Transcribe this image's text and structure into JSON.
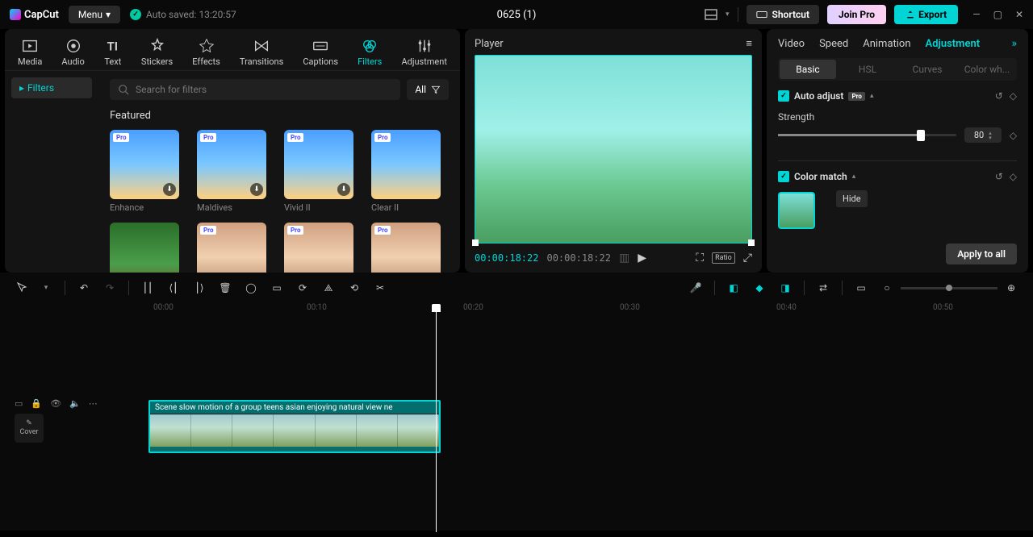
{
  "titlebar": {
    "logo": "CapCut",
    "menu": "Menu",
    "autosave": "Auto saved: 13:20:57",
    "project_title": "0625 (1)",
    "shortcut": "Shortcut",
    "join_pro": "Join Pro",
    "export": "Export"
  },
  "media_tabs": {
    "media": "Media",
    "audio": "Audio",
    "text": "Text",
    "stickers": "Stickers",
    "effects": "Effects",
    "transitions": "Transitions",
    "captions": "Captions",
    "filters": "Filters",
    "adjustment": "Adjustment"
  },
  "filters_panel": {
    "sidebar_label": "Filters",
    "search_placeholder": "Search for filters",
    "all": "All",
    "section": "Featured",
    "items": {
      "0": {
        "label": "Enhance",
        "pro": "Pro"
      },
      "1": {
        "label": "Maldives",
        "pro": "Pro"
      },
      "2": {
        "label": "Vivid II",
        "pro": "Pro"
      },
      "3": {
        "label": "Clear II",
        "pro": "Pro"
      },
      "4": {
        "label": "",
        "pro": ""
      },
      "5": {
        "label": "",
        "pro": "Pro"
      },
      "6": {
        "label": "",
        "pro": "Pro"
      },
      "7": {
        "label": "",
        "pro": "Pro"
      }
    }
  },
  "player": {
    "title": "Player",
    "current": "00:00:18:22",
    "total": "00:00:18:22",
    "ratio": "Ratio"
  },
  "right": {
    "tabs": {
      "video": "Video",
      "speed": "Speed",
      "animation": "Animation",
      "adjustment": "Adjustment"
    },
    "subtabs": {
      "basic": "Basic",
      "hsl": "HSL",
      "curves": "Curves",
      "colorwheel": "Color wh..."
    },
    "auto_adjust": "Auto adjust",
    "pro": "Pro",
    "strength": "Strength",
    "strength_value": "80",
    "color_match": "Color match",
    "hide": "Hide",
    "apply": "Apply to all"
  },
  "timeline": {
    "ruler": {
      "0": "00:00",
      "1": "00:10",
      "2": "00:20",
      "3": "00:30",
      "4": "00:40",
      "5": "00:50"
    },
    "cover": "Cover",
    "clip_title": "Scene slow motion of a group teens asian enjoying natural view ne"
  }
}
